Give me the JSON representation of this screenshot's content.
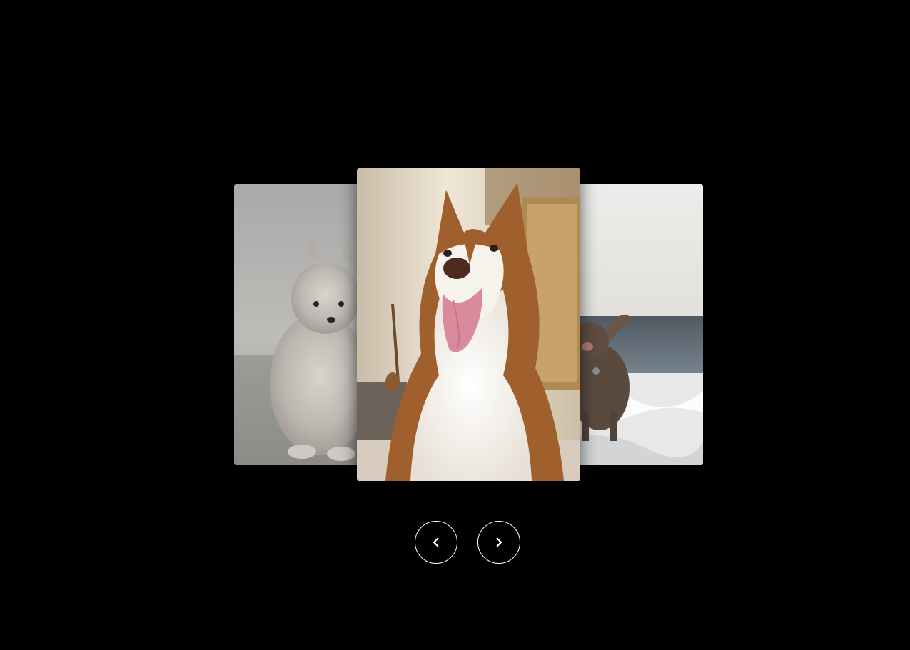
{
  "carousel": {
    "slides": [
      {
        "position": "left",
        "subject": "pomeranian-puppy"
      },
      {
        "position": "center",
        "subject": "husky"
      },
      {
        "position": "right",
        "subject": "brown-dog-on-beach"
      }
    ],
    "active_index": 1
  },
  "controls": {
    "prev_icon": "chevron-left-icon",
    "next_icon": "chevron-right-icon",
    "icon_color": "#ffffff",
    "background": "#000000"
  }
}
